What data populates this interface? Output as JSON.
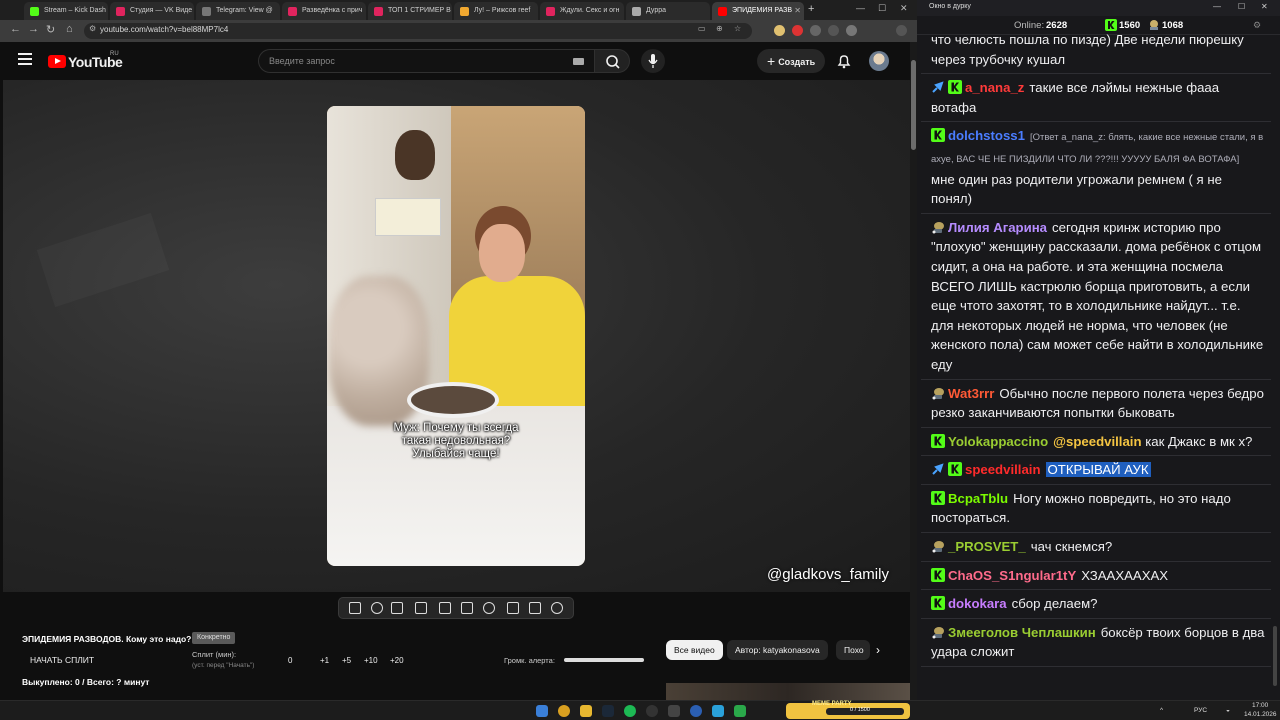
{
  "browser": {
    "tabs": [
      {
        "label": "Stream – Kick Dash",
        "color": "#53fc18"
      },
      {
        "label": "Студия — VK Виде",
        "color": "#e0245e"
      },
      {
        "label": "Telegram: View @",
        "color": "#777777"
      },
      {
        "label": "Разведёнка с прич",
        "color": "#e0245e"
      },
      {
        "label": "ТОП 1 СТРИМЕР В",
        "color": "#e0245e"
      },
      {
        "label": "Лу! – Рижсов reef",
        "color": "#f0a830"
      },
      {
        "label": "Ждули. Секс и огн",
        "color": "#e0245e"
      },
      {
        "label": "Дурра",
        "color": "#aaaaaa"
      },
      {
        "label": "ЭПИДЕМИЯ РАЗВ",
        "color": "#ff0000"
      }
    ],
    "url": "youtube.com/watch?v=bel88MP7lc4"
  },
  "youtube": {
    "logo": "YouTube",
    "region": "RU",
    "search_placeholder": "Введите запрос",
    "create_label": "Создать"
  },
  "video": {
    "caption_line1": "Муж: Почему ты всегда",
    "caption_line2": "такая недовольная?",
    "caption_line3": "Улыбайся чаще!",
    "watermark": "@gladkovs_family"
  },
  "split": {
    "title": "ЭПИДЕМИЯ РАЗВОДОВ. Кому это надо?",
    "tag": "Конкретно",
    "start_button": "НАЧАТЬ СПЛИТ",
    "min_label": "Сплит (мин):",
    "min_hint": "(уст. перед \"Начать\")",
    "values": [
      "0",
      "+1",
      "+5",
      "+10",
      "+20"
    ],
    "alert_label": "Громк. алерта:",
    "status": "Выкуплено: 0 / Всего: ? минут"
  },
  "chips": {
    "all": "Все видео",
    "author": "Автор: katyakonasova",
    "similar": "Похо"
  },
  "chat": {
    "window_title": "Окно в дурку",
    "online_label": "Online:",
    "online": "2628",
    "kick_count": "1560",
    "vk_count": "1068",
    "messages": [
      {
        "user": "",
        "color": "#efeff1",
        "text": "что челюсть пошла по пизде) Две недели пюрешку через трубочку кушал",
        "badges": []
      },
      {
        "user": "a_nana_z",
        "color": "#ff3a3a",
        "text": "такие все лэймы нежные фааа вотафа",
        "badges": [
          "pin",
          "kick"
        ]
      },
      {
        "user": "dolchstoss1",
        "color": "#4a7dff",
        "reply": "[Ответ a_nana_z: блять, какие все нежные стали, я в ахуе, ВАС ЧЕ НЕ ПИЗДИЛИ ЧТО ЛИ ???!!! УУУУУ БАЛЯ ФА ВОТАФА]",
        "text": "мне один раз родители угрожали ремнем ( я не понял)",
        "badges": [
          "kick"
        ]
      },
      {
        "user": "Лилия Агарина",
        "color": "#b68cff",
        "text": "сегодня кринж историю про \"плохую\" женщину рассказали. дома ребёнок с отцом сидит, а она на работе. и эта женщина посмела ВСЕГО ЛИШЬ кастрюлю борща приготовить, а если еще чтото захотят, то в холодильнике найдут... т.е. для некоторых людей не норма, что человек (не женского пола) сам может себе найти в холодильнике еду",
        "badges": [
          "vk"
        ]
      },
      {
        "user": "Wat3rrr",
        "color": "#ff5a36",
        "text": "Обычно после первого полета через бедро резко заканчиваются попытки быковать",
        "badges": [
          "vk"
        ]
      },
      {
        "user": "Yolokappaccino",
        "color": "#9acd32",
        "mention": "@speedvillain",
        "text": "как Джакс в мк х?",
        "badges": [
          "kick"
        ]
      },
      {
        "user": "speedvillain",
        "color": "#ff2b2b",
        "highlight": "ОТКРЫВАЙ АУК",
        "text": "",
        "badges": [
          "pin",
          "kick"
        ]
      },
      {
        "user": "BcpaTblu",
        "color": "#7cfc00",
        "text": "Ногу можно повредить, но это надо постораться.",
        "badges": [
          "kick"
        ]
      },
      {
        "user": "_PROSVET_",
        "color": "#9acd32",
        "text": "чач скнемся?",
        "badges": [
          "vk"
        ]
      },
      {
        "user": "ChaOS_S1ngular1tY",
        "color": "#ff6b8b",
        "text": "ХЗААХААХАХ",
        "badges": [
          "kick"
        ]
      },
      {
        "user": "dokokara",
        "color": "#c77dff",
        "text": "сбор делаем?",
        "badges": [
          "kick"
        ]
      },
      {
        "user": "Змееголов Чеплашкин",
        "color": "#9acd32",
        "text": "боксёр твоих борцов в два удара сложит",
        "badges": [
          "vk"
        ]
      }
    ]
  },
  "taskbar": {
    "widget_name": "MEME PARTY",
    "widget_progress": "0 / 1500",
    "lang": "РУС",
    "time": "17:00",
    "date": "14.01.2026"
  }
}
